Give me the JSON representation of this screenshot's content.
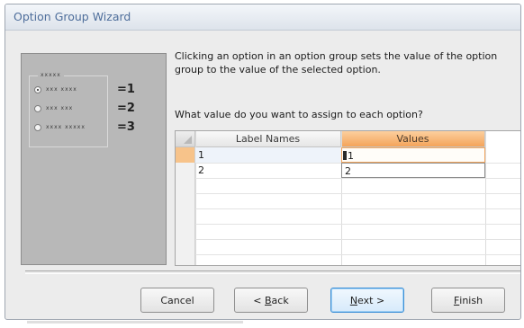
{
  "dialog": {
    "title": "Option Group Wizard"
  },
  "preview": {
    "caption": "xxxxx",
    "options": [
      {
        "label": "xxx xxxx",
        "value": "=1",
        "selected": true
      },
      {
        "label": "xxx xxx",
        "value": "=2",
        "selected": false
      },
      {
        "label": "xxxx xxxxx",
        "value": "=3",
        "selected": false
      }
    ]
  },
  "description": "Clicking an option in an option group sets the value of the option group to the value of the selected option.",
  "question": "What value do you want to assign to each option?",
  "grid": {
    "columns": [
      "Label Names",
      "Values"
    ],
    "rows": [
      {
        "label": "1",
        "value": "1"
      },
      {
        "label": "2",
        "value": "2"
      }
    ]
  },
  "buttons": {
    "cancel": "Cancel",
    "back": {
      "prefix": "< ",
      "mnemonic": "B",
      "rest": "ack"
    },
    "next": {
      "mnemonic": "N",
      "rest": "ext >"
    },
    "finish": {
      "mnemonic": "F",
      "rest": "inish"
    }
  },
  "colors": {
    "accent": "#f4a45a",
    "default_button_border": "#3c8fd6",
    "title_text": "#4e6e9b"
  }
}
